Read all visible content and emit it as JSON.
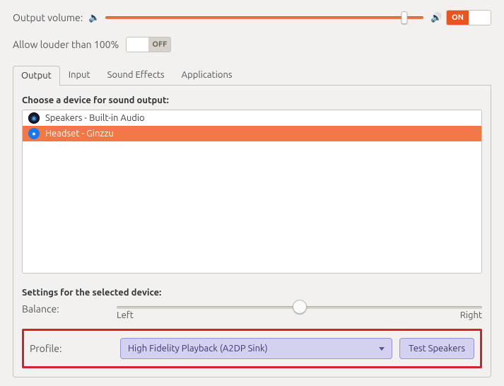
{
  "volume": {
    "label": "Output volume:",
    "percent": 94,
    "toggle_on_label": "ON",
    "toggle_state": "on"
  },
  "louder": {
    "label": "Allow louder than 100%",
    "toggle_off_label": "OFF",
    "toggle_state": "off"
  },
  "tabs": {
    "output": "Output",
    "input": "Input",
    "effects": "Sound Effects",
    "apps": "Applications",
    "active": "output"
  },
  "output_page": {
    "choose_heading": "Choose a device for sound output:",
    "devices": [
      {
        "icon": "speaker-icon",
        "label": "Speakers - Built-in Audio",
        "selected": false
      },
      {
        "icon": "bluetooth-icon",
        "label": "Headset - Ginzzu",
        "selected": true
      }
    ],
    "settings_heading": "Settings for the selected device:",
    "balance": {
      "label": "Balance:",
      "left": "Left",
      "right": "Right",
      "value": 50
    },
    "profile": {
      "label": "Profile:",
      "selected": "High Fidelity Playback (A2DP Sink)",
      "test_button": "Test Speakers"
    }
  },
  "colors": {
    "accent": "#e95420",
    "selection": "#f07746",
    "highlight_border": "#d2232a",
    "combo_bg": "#d3d1ef"
  }
}
